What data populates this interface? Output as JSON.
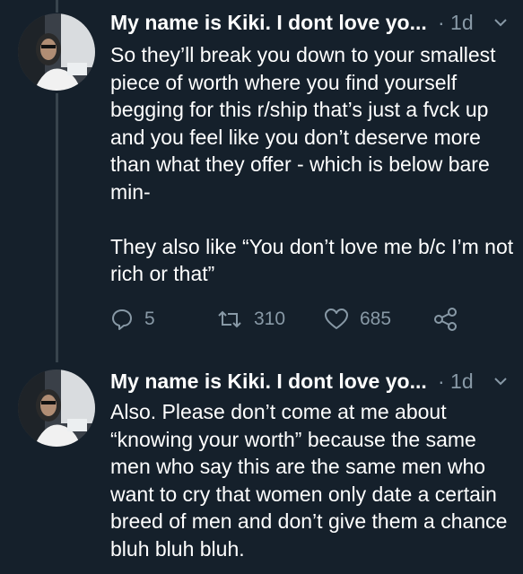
{
  "tweets": [
    {
      "name": "My name is Kiki. I dont love yo...",
      "time": "· 1d",
      "text": "So they’ll break you down to your smallest piece of worth where you find yourself begging for this r/ship that’s just a fvck up and you feel like you don’t deserve more than what they offer - which is below bare min-\n\nThey also like “You don’t love me b/c I’m not rich or that”",
      "replies": "5",
      "retweets": "310",
      "likes": "685"
    },
    {
      "name": "My name is Kiki. I dont love yo...",
      "time": "· 1d",
      "text": "Also. Please don’t come at me about “knowing your worth” because the same men who say this are the same men who want to cry that women only date a certain breed of men and don’t give them a chance bluh bluh bluh."
    }
  ],
  "icons": [
    "reply-icon",
    "retweet-icon",
    "like-icon",
    "share-icon",
    "chevron-down-icon"
  ],
  "colors": {
    "background": "#15202b",
    "secondary_text": "#8899a6",
    "thread_line": "#38444d"
  }
}
